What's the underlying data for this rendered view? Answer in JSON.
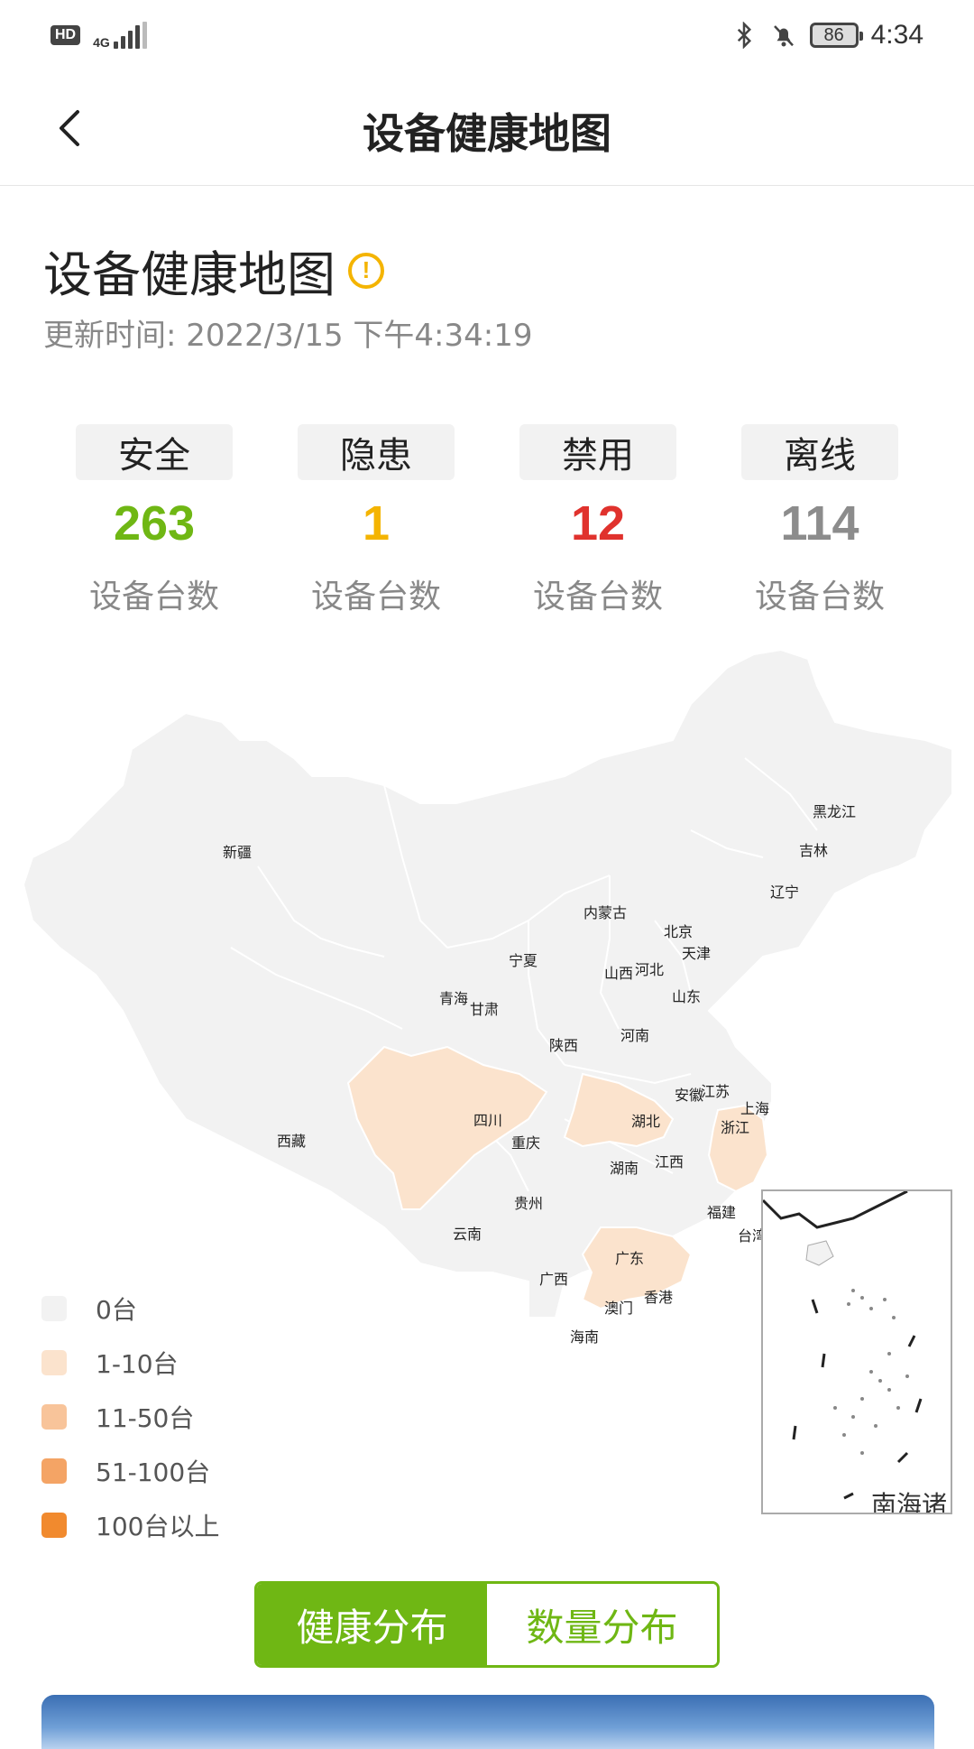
{
  "status_bar": {
    "hd": "HD",
    "network": "4G",
    "battery": "86",
    "time": "4:34"
  },
  "app_bar": {
    "title": "设备健康地图"
  },
  "header": {
    "title": "设备健康地图",
    "info_icon_glyph": "!",
    "update_label": "更新时间: ",
    "update_time": "2022/3/15 下午4:34:19"
  },
  "stats": [
    {
      "label": "安全",
      "value": "263",
      "sub": "设备台数",
      "color": "#6fb714"
    },
    {
      "label": "隐患",
      "value": "1",
      "sub": "设备台数",
      "color": "#f4b400"
    },
    {
      "label": "禁用",
      "value": "12",
      "sub": "设备台数",
      "color": "#e0322d"
    },
    {
      "label": "离线",
      "value": "114",
      "sub": "设备台数",
      "color": "#8c8c8c"
    }
  ],
  "map": {
    "provinces": [
      {
        "name": "新疆",
        "level": 0
      },
      {
        "name": "西藏",
        "level": 0
      },
      {
        "name": "青海",
        "level": 0
      },
      {
        "name": "甘肃",
        "level": 0
      },
      {
        "name": "内蒙古",
        "level": 0
      },
      {
        "name": "黑龙江",
        "level": 0
      },
      {
        "name": "吉林",
        "level": 0
      },
      {
        "name": "辽宁",
        "level": 0
      },
      {
        "name": "北京",
        "level": 0
      },
      {
        "name": "天津",
        "level": 0
      },
      {
        "name": "宁夏",
        "level": 0
      },
      {
        "name": "山西",
        "level": 0
      },
      {
        "name": "河北",
        "level": 0
      },
      {
        "name": "山东",
        "level": 0
      },
      {
        "name": "陕西",
        "level": 0
      },
      {
        "name": "河南",
        "level": 0
      },
      {
        "name": "安徽",
        "level": 0
      },
      {
        "name": "江苏",
        "level": 0
      },
      {
        "name": "上海",
        "level": 0
      },
      {
        "name": "四川",
        "level": 1
      },
      {
        "name": "湖北",
        "level": 1
      },
      {
        "name": "浙江",
        "level": 1
      },
      {
        "name": "重庆",
        "level": 0
      },
      {
        "name": "湖南",
        "level": 0
      },
      {
        "name": "江西",
        "level": 0
      },
      {
        "name": "贵州",
        "level": 0
      },
      {
        "name": "福建",
        "level": 0
      },
      {
        "name": "云南",
        "level": 0
      },
      {
        "name": "广东",
        "level": 1
      },
      {
        "name": "台湾",
        "level": 0
      },
      {
        "name": "广西",
        "level": 0
      },
      {
        "name": "香港",
        "level": 0
      },
      {
        "name": "澳门",
        "level": 0
      },
      {
        "name": "海南",
        "level": 0
      }
    ],
    "inset_label": "南海诸"
  },
  "legend": [
    {
      "label": "0台",
      "color": "#f2f2f2"
    },
    {
      "label": "1-10台",
      "color": "#fbe3cd"
    },
    {
      "label": "11-50台",
      "color": "#f8c49a"
    },
    {
      "label": "51-100台",
      "color": "#f4a465"
    },
    {
      "label": "100台以上",
      "color": "#f18a2e"
    }
  ],
  "toggle": {
    "active_label": "健康分布",
    "inactive_label": "数量分布"
  }
}
